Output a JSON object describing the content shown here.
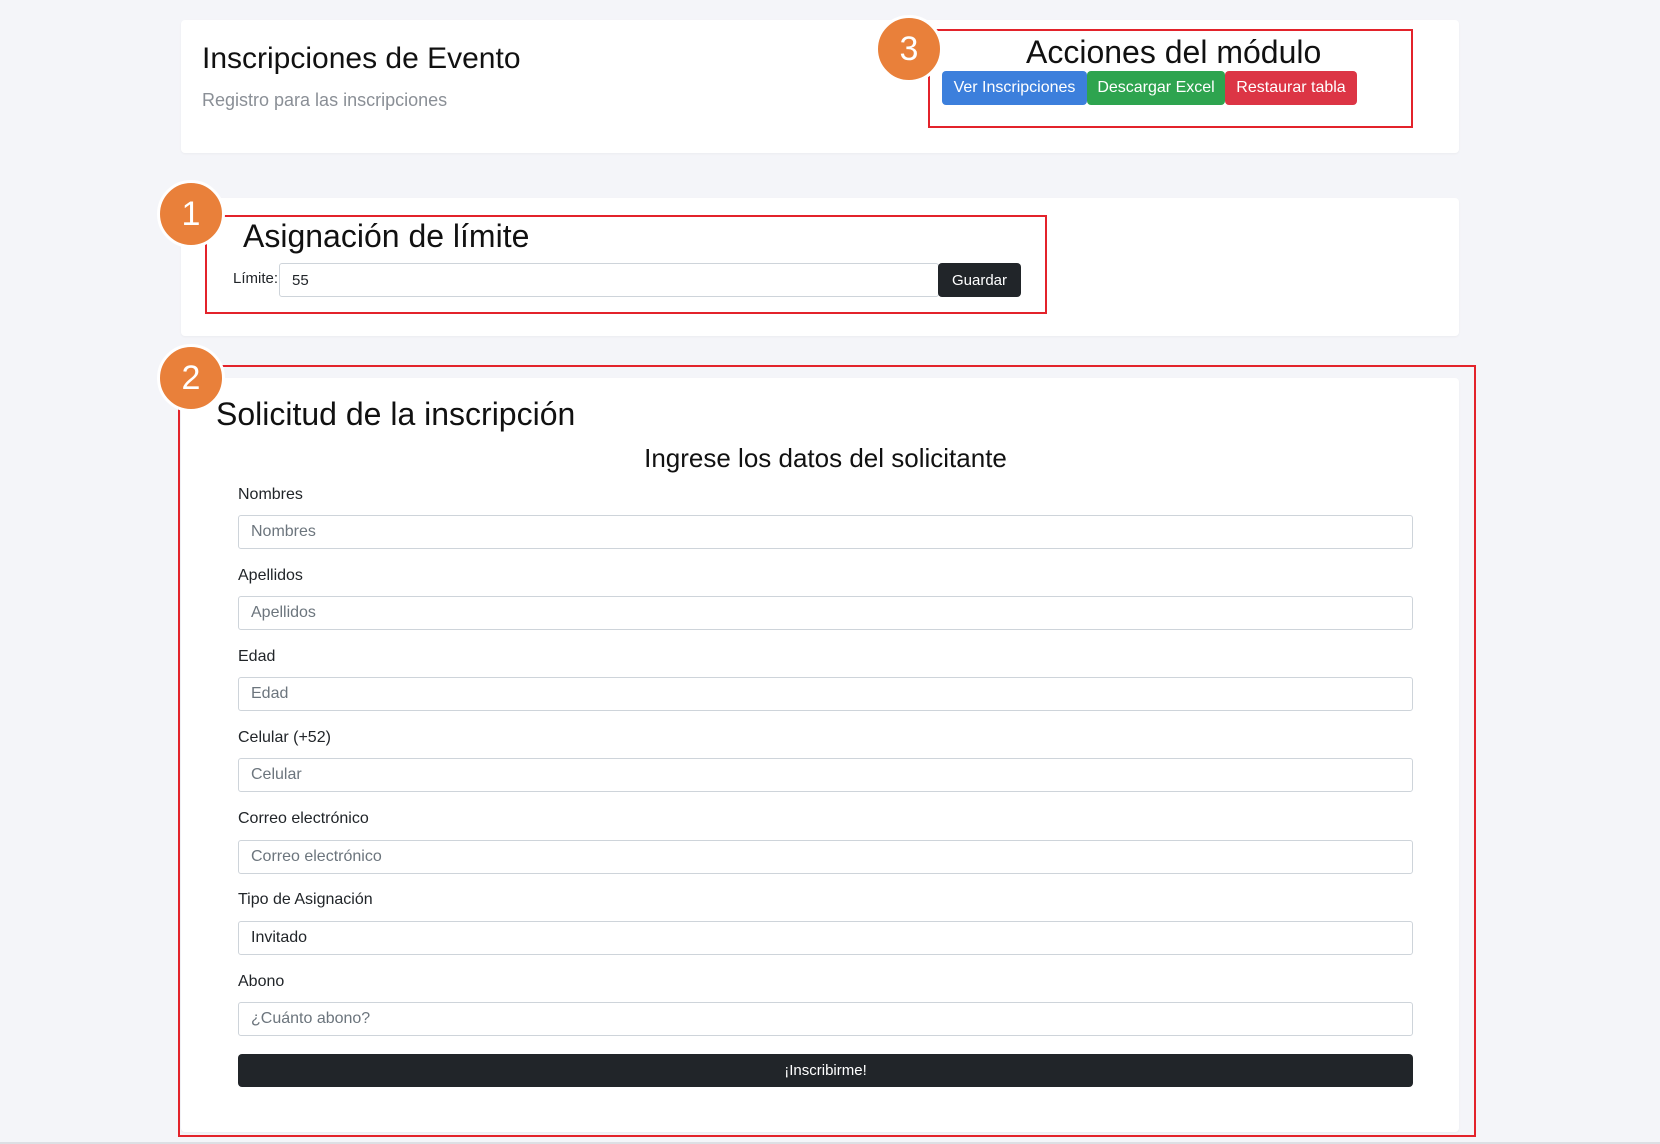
{
  "header": {
    "title": "Inscripciones de Evento",
    "subtitle": "Registro para las inscripciones"
  },
  "actions": {
    "badge": "3",
    "title": "Acciones del módulo",
    "ver_label": "Ver Inscripciones",
    "descargar_label": "Descargar Excel",
    "restaurar_label": "Restaurar tabla",
    "colors": {
      "ver": "#3c7fdc",
      "descargar": "#2ea44f",
      "restaurar": "#dc3545"
    }
  },
  "limit": {
    "badge": "1",
    "title": "Asignación de límite",
    "label": "Límite:",
    "value": "55",
    "save_label": "Guardar"
  },
  "form": {
    "badge": "2",
    "title": "Solicitud de la inscripción",
    "subtitle": "Ingrese los datos del solicitante",
    "fields": [
      {
        "label": "Nombres",
        "placeholder": "Nombres",
        "value": ""
      },
      {
        "label": "Apellidos",
        "placeholder": "Apellidos",
        "value": ""
      },
      {
        "label": "Edad",
        "placeholder": "Edad",
        "value": ""
      },
      {
        "label": "Celular (+52)",
        "placeholder": "Celular",
        "value": ""
      },
      {
        "label": "Correo electrónico",
        "placeholder": "Correo electrónico",
        "value": ""
      },
      {
        "label": "Tipo de Asignación",
        "placeholder": "",
        "value": "Invitado"
      },
      {
        "label": "Abono",
        "placeholder": "¿Cuánto abono?",
        "value": ""
      }
    ],
    "submit_label": "¡Inscribirme!"
  },
  "colors": {
    "annotation": "#e3232b",
    "badge": "#e9803a",
    "dark_button": "#212529"
  }
}
